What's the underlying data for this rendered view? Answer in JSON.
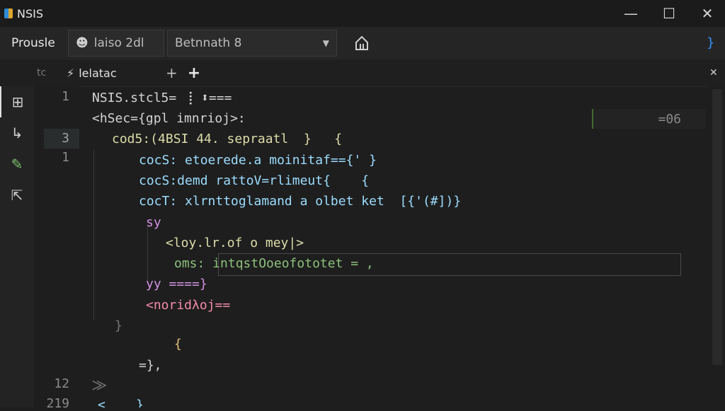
{
  "window": {
    "title": "NSIS",
    "controls": {
      "minimize": "—",
      "maximize": "☐",
      "close": "✕"
    }
  },
  "toolbar": {
    "browse_label": "Prousle",
    "profile_select": {
      "icon": "person-icon",
      "value": "laiso 2dl"
    },
    "target_select": {
      "value": "Betnnath 8"
    },
    "home_icon": "home-icon",
    "right_glyph": "}"
  },
  "tabs": {
    "prefix": "tc",
    "active_tab": "lelatac",
    "add_labels": [
      "+",
      "+"
    ],
    "close_glyph": "✕"
  },
  "activity_bar": {
    "items": [
      {
        "icon": "explorer-icon",
        "glyph": "⊞"
      },
      {
        "icon": "branch-icon",
        "glyph": "↳"
      },
      {
        "icon": "edit-icon",
        "glyph": "✎"
      },
      {
        "icon": "chart-icon",
        "glyph": "⇱"
      }
    ]
  },
  "editor": {
    "line_numbers": [
      "1",
      "1",
      "3",
      "1",
      "12",
      "219"
    ],
    "hint": "=06",
    "lines": [
      {
        "indent": 0,
        "text": "NSIS.stcl5= ⢸ ⬍==="
      },
      {
        "indent": 0,
        "text": "<hSec={gpl imnrioj>:"
      },
      {
        "indent": 1,
        "text": "cod5:(4BSI 44. sepraatl  }   {"
      },
      {
        "indent": 2,
        "text": "cocS: etoerede.a moinitaf=={' }"
      },
      {
        "indent": 2,
        "text": "cocS:demd rattoV=rlimeut{    {"
      },
      {
        "indent": 2,
        "text": "cocT: xlrnttoglamand a olbet ket  [{'(#])}"
      },
      {
        "indent": 3,
        "text": "sy"
      },
      {
        "indent": 4,
        "text": "<loy.lr.of o mey|>"
      },
      {
        "indent": 4,
        "text": "oms: intqstOoeofototet = ,"
      },
      {
        "indent": 3,
        "text": "yy ====}"
      },
      {
        "indent": 3,
        "text": "<noridλoj=="
      },
      {
        "indent": 1,
        "text": "}"
      },
      {
        "indent": 4,
        "text": "{"
      },
      {
        "indent": 3,
        "text": "=},"
      },
      {
        "indent": 0,
        "text": "⨠"
      },
      {
        "indent": 0,
        "text": "<    }"
      }
    ]
  }
}
